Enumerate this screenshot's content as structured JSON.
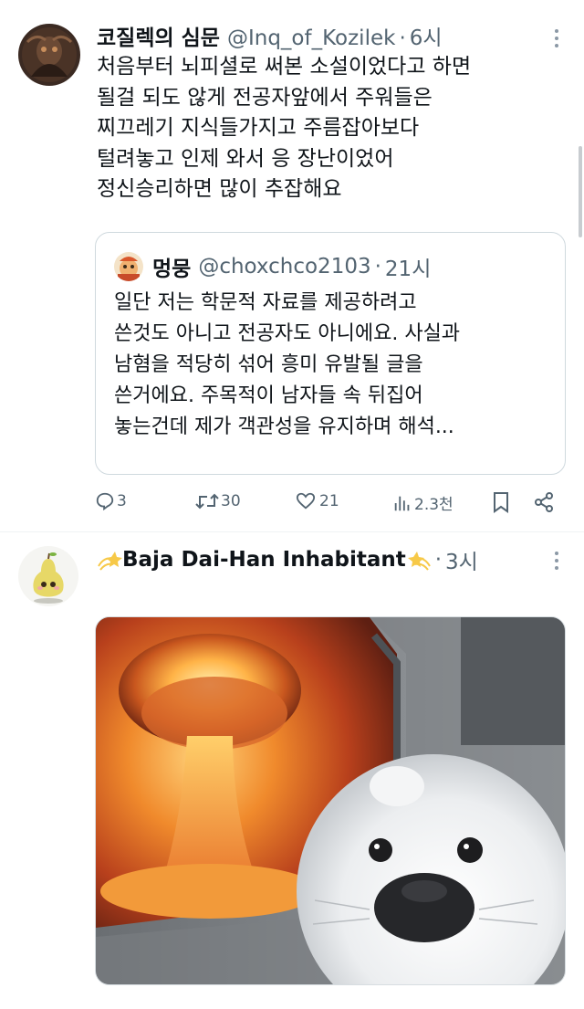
{
  "tweet1": {
    "display_name": "코질렉의 심문",
    "handle": "@Inq_of_Kozilek",
    "separator": "·",
    "time": "6시",
    "avatar_icon": "dark-fantasy-avatar",
    "text_lines": [
      "처음부터 뇌피셜로 써본 소설이었다고 하면",
      "될걸 되도 않게 전공자앞에서 주워들은",
      "찌끄레기 지식들가지고 주름잡아보다",
      "털려놓고 인제 와서 응 장난이었어",
      "정신승리하면 많이 추잡해요"
    ],
    "quote": {
      "display_name": "멍뭉",
      "handle": "@choxchco2103",
      "separator": "·",
      "time": "21시",
      "avatar_icon": "cartoon-avatar",
      "text_lines": [
        "일단 저는 학문적 자료를 제공하려고",
        "쓴것도 아니고 전공자도 아니에요. 사실과",
        "남혐을 적당히 섞어 흥미 유발될 글을",
        "쓴거에요. 주목적이 남자들 속 뒤집어",
        "놓는건데 제가 객관성을 유지하며 해석..."
      ]
    },
    "actions": {
      "replies": "3",
      "retweets": "30",
      "likes": "21",
      "views": "2.3천"
    }
  },
  "tweet2": {
    "display_name": "Baja Dai-Han Inhabitant",
    "separator": "·",
    "time": "3시",
    "avatar_icon": "pear-character-avatar",
    "name_emoji": "dizzy-star-icon",
    "media_icon": "explosion-seal-image"
  },
  "colors": {
    "text": "#0f1419",
    "secondary": "#536471",
    "border": "#cfd9de"
  }
}
